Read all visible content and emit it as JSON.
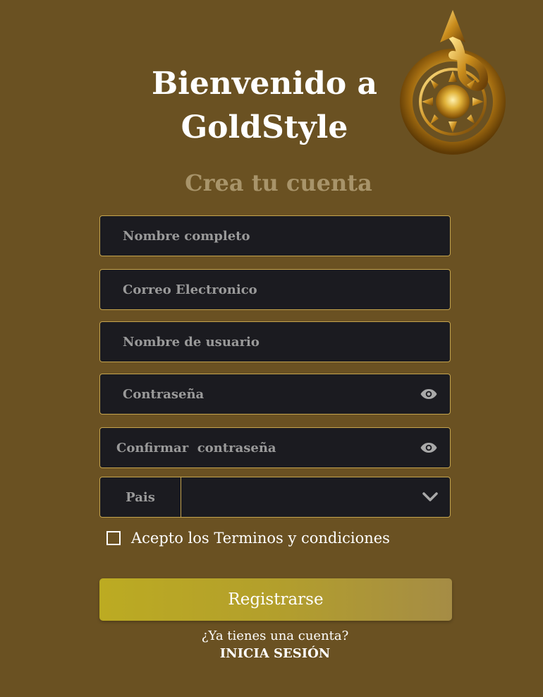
{
  "header": {
    "title_line1": "Bienvenido a",
    "title_line2": "GoldStyle",
    "subtitle": "Crea tu cuenta"
  },
  "form": {
    "full_name_placeholder": "Nombre completo",
    "email_placeholder": "Correo Electronico",
    "username_placeholder": "Nombre de usuario",
    "password_placeholder": "Contraseña",
    "confirm_password_placeholder": "Confirmar  contraseña",
    "country_label": "Pais",
    "terms_label": "Acepto los Terminos y condiciones",
    "register_label": "Registrarse"
  },
  "footer": {
    "question": "¿Ya tienes una cuenta?",
    "login_link": "INICIA SESIÓN"
  },
  "colors": {
    "background": "#6a5122",
    "field_bg": "#1b1b20",
    "field_border": "#c5a44d",
    "subtitle": "#a8946a"
  },
  "icons": [
    "compass-logo-icon",
    "eye-icon",
    "chevron-down-icon"
  ]
}
